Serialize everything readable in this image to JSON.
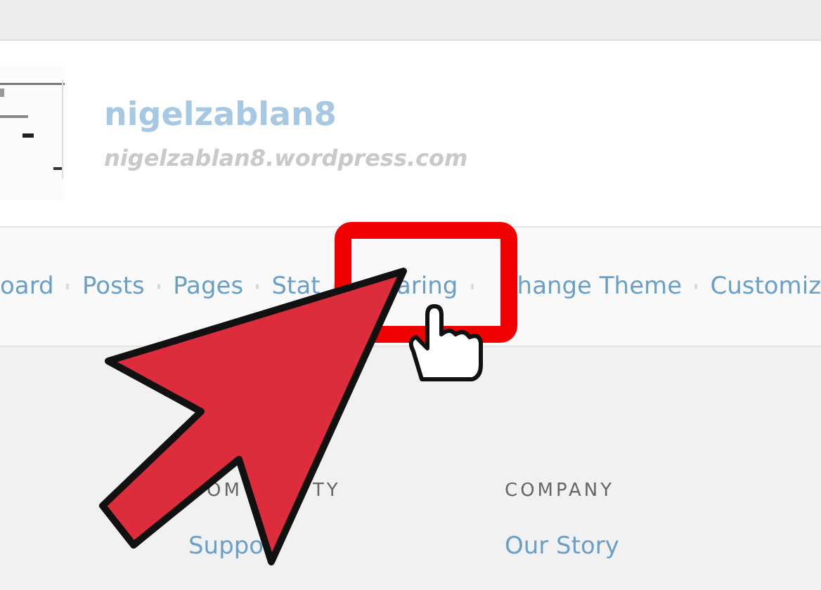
{
  "site": {
    "title": "nigelzablan8",
    "url": "nigelzablan8.wordpress.com"
  },
  "nav": [
    {
      "label": "oard"
    },
    {
      "label": "Posts"
    },
    {
      "label": "Pages"
    },
    {
      "label": "Stat"
    },
    {
      "label": "aring"
    },
    {
      "label": "hange Theme"
    },
    {
      "label": "Customiz"
    }
  ],
  "footer": {
    "columns": [
      {
        "heading_parts": [
          "OM",
          "TY"
        ],
        "links": [
          "Suppo"
        ]
      },
      {
        "heading_parts": [
          "COMPANY"
        ],
        "links": [
          "Our Story"
        ]
      }
    ]
  }
}
